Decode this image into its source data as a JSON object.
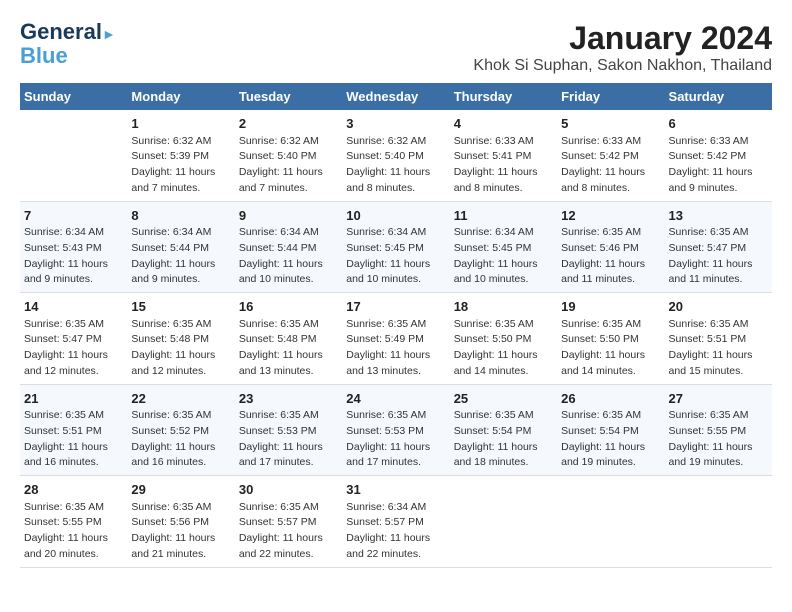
{
  "header": {
    "logo_line1": "General",
    "logo_line2": "Blue",
    "title": "January 2024",
    "subtitle": "Khok Si Suphan, Sakon Nakhon, Thailand"
  },
  "calendar": {
    "days_of_week": [
      "Sunday",
      "Monday",
      "Tuesday",
      "Wednesday",
      "Thursday",
      "Friday",
      "Saturday"
    ],
    "weeks": [
      [
        {
          "num": "",
          "info": ""
        },
        {
          "num": "1",
          "info": "Sunrise: 6:32 AM\nSunset: 5:39 PM\nDaylight: 11 hours\nand 7 minutes."
        },
        {
          "num": "2",
          "info": "Sunrise: 6:32 AM\nSunset: 5:40 PM\nDaylight: 11 hours\nand 7 minutes."
        },
        {
          "num": "3",
          "info": "Sunrise: 6:32 AM\nSunset: 5:40 PM\nDaylight: 11 hours\nand 8 minutes."
        },
        {
          "num": "4",
          "info": "Sunrise: 6:33 AM\nSunset: 5:41 PM\nDaylight: 11 hours\nand 8 minutes."
        },
        {
          "num": "5",
          "info": "Sunrise: 6:33 AM\nSunset: 5:42 PM\nDaylight: 11 hours\nand 8 minutes."
        },
        {
          "num": "6",
          "info": "Sunrise: 6:33 AM\nSunset: 5:42 PM\nDaylight: 11 hours\nand 9 minutes."
        }
      ],
      [
        {
          "num": "7",
          "info": "Sunrise: 6:34 AM\nSunset: 5:43 PM\nDaylight: 11 hours\nand 9 minutes."
        },
        {
          "num": "8",
          "info": "Sunrise: 6:34 AM\nSunset: 5:44 PM\nDaylight: 11 hours\nand 9 minutes."
        },
        {
          "num": "9",
          "info": "Sunrise: 6:34 AM\nSunset: 5:44 PM\nDaylight: 11 hours\nand 10 minutes."
        },
        {
          "num": "10",
          "info": "Sunrise: 6:34 AM\nSunset: 5:45 PM\nDaylight: 11 hours\nand 10 minutes."
        },
        {
          "num": "11",
          "info": "Sunrise: 6:34 AM\nSunset: 5:45 PM\nDaylight: 11 hours\nand 10 minutes."
        },
        {
          "num": "12",
          "info": "Sunrise: 6:35 AM\nSunset: 5:46 PM\nDaylight: 11 hours\nand 11 minutes."
        },
        {
          "num": "13",
          "info": "Sunrise: 6:35 AM\nSunset: 5:47 PM\nDaylight: 11 hours\nand 11 minutes."
        }
      ],
      [
        {
          "num": "14",
          "info": "Sunrise: 6:35 AM\nSunset: 5:47 PM\nDaylight: 11 hours\nand 12 minutes."
        },
        {
          "num": "15",
          "info": "Sunrise: 6:35 AM\nSunset: 5:48 PM\nDaylight: 11 hours\nand 12 minutes."
        },
        {
          "num": "16",
          "info": "Sunrise: 6:35 AM\nSunset: 5:48 PM\nDaylight: 11 hours\nand 13 minutes."
        },
        {
          "num": "17",
          "info": "Sunrise: 6:35 AM\nSunset: 5:49 PM\nDaylight: 11 hours\nand 13 minutes."
        },
        {
          "num": "18",
          "info": "Sunrise: 6:35 AM\nSunset: 5:50 PM\nDaylight: 11 hours\nand 14 minutes."
        },
        {
          "num": "19",
          "info": "Sunrise: 6:35 AM\nSunset: 5:50 PM\nDaylight: 11 hours\nand 14 minutes."
        },
        {
          "num": "20",
          "info": "Sunrise: 6:35 AM\nSunset: 5:51 PM\nDaylight: 11 hours\nand 15 minutes."
        }
      ],
      [
        {
          "num": "21",
          "info": "Sunrise: 6:35 AM\nSunset: 5:51 PM\nDaylight: 11 hours\nand 16 minutes."
        },
        {
          "num": "22",
          "info": "Sunrise: 6:35 AM\nSunset: 5:52 PM\nDaylight: 11 hours\nand 16 minutes."
        },
        {
          "num": "23",
          "info": "Sunrise: 6:35 AM\nSunset: 5:53 PM\nDaylight: 11 hours\nand 17 minutes."
        },
        {
          "num": "24",
          "info": "Sunrise: 6:35 AM\nSunset: 5:53 PM\nDaylight: 11 hours\nand 17 minutes."
        },
        {
          "num": "25",
          "info": "Sunrise: 6:35 AM\nSunset: 5:54 PM\nDaylight: 11 hours\nand 18 minutes."
        },
        {
          "num": "26",
          "info": "Sunrise: 6:35 AM\nSunset: 5:54 PM\nDaylight: 11 hours\nand 19 minutes."
        },
        {
          "num": "27",
          "info": "Sunrise: 6:35 AM\nSunset: 5:55 PM\nDaylight: 11 hours\nand 19 minutes."
        }
      ],
      [
        {
          "num": "28",
          "info": "Sunrise: 6:35 AM\nSunset: 5:55 PM\nDaylight: 11 hours\nand 20 minutes."
        },
        {
          "num": "29",
          "info": "Sunrise: 6:35 AM\nSunset: 5:56 PM\nDaylight: 11 hours\nand 21 minutes."
        },
        {
          "num": "30",
          "info": "Sunrise: 6:35 AM\nSunset: 5:57 PM\nDaylight: 11 hours\nand 22 minutes."
        },
        {
          "num": "31",
          "info": "Sunrise: 6:34 AM\nSunset: 5:57 PM\nDaylight: 11 hours\nand 22 minutes."
        },
        {
          "num": "",
          "info": ""
        },
        {
          "num": "",
          "info": ""
        },
        {
          "num": "",
          "info": ""
        }
      ]
    ]
  }
}
